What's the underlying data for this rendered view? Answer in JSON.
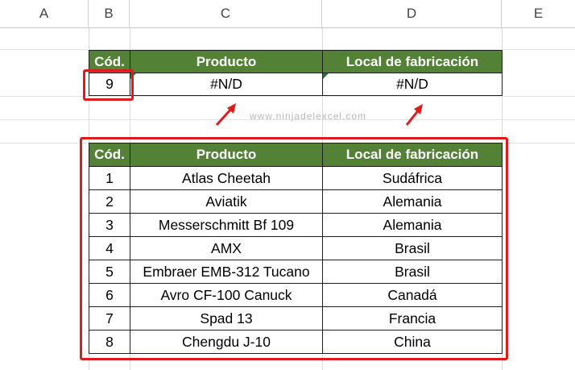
{
  "column_headers": [
    "A",
    "B",
    "C",
    "D",
    "E"
  ],
  "lookup_table": {
    "headers": [
      "Cód.",
      "Producto",
      "Local de fabricación"
    ],
    "row": [
      "9",
      "#N/D",
      "#N/D"
    ]
  },
  "main_table": {
    "headers": [
      "Cód.",
      "Producto",
      "Local de fabricación"
    ],
    "rows": [
      [
        "1",
        "Atlas Cheetah",
        "Sudáfrica"
      ],
      [
        "2",
        "Aviatik",
        "Alemania"
      ],
      [
        "3",
        "Messerschmitt Bf 109",
        "Alemania"
      ],
      [
        "4",
        "AMX",
        "Brasil"
      ],
      [
        "5",
        "Embraer EMB-312 Tucano",
        "Brasil"
      ],
      [
        "6",
        "Avro CF-100 Canuck",
        "Canadá"
      ],
      [
        "7",
        "Spad 13",
        "Francia"
      ],
      [
        "8",
        "Chengdu J-10",
        "China"
      ]
    ]
  },
  "watermark": "www.ninjadelexcel.com",
  "colors": {
    "header_fill": "#538135",
    "highlight_red": "#e01b1b",
    "error_indicator": "#1e7b3a"
  }
}
